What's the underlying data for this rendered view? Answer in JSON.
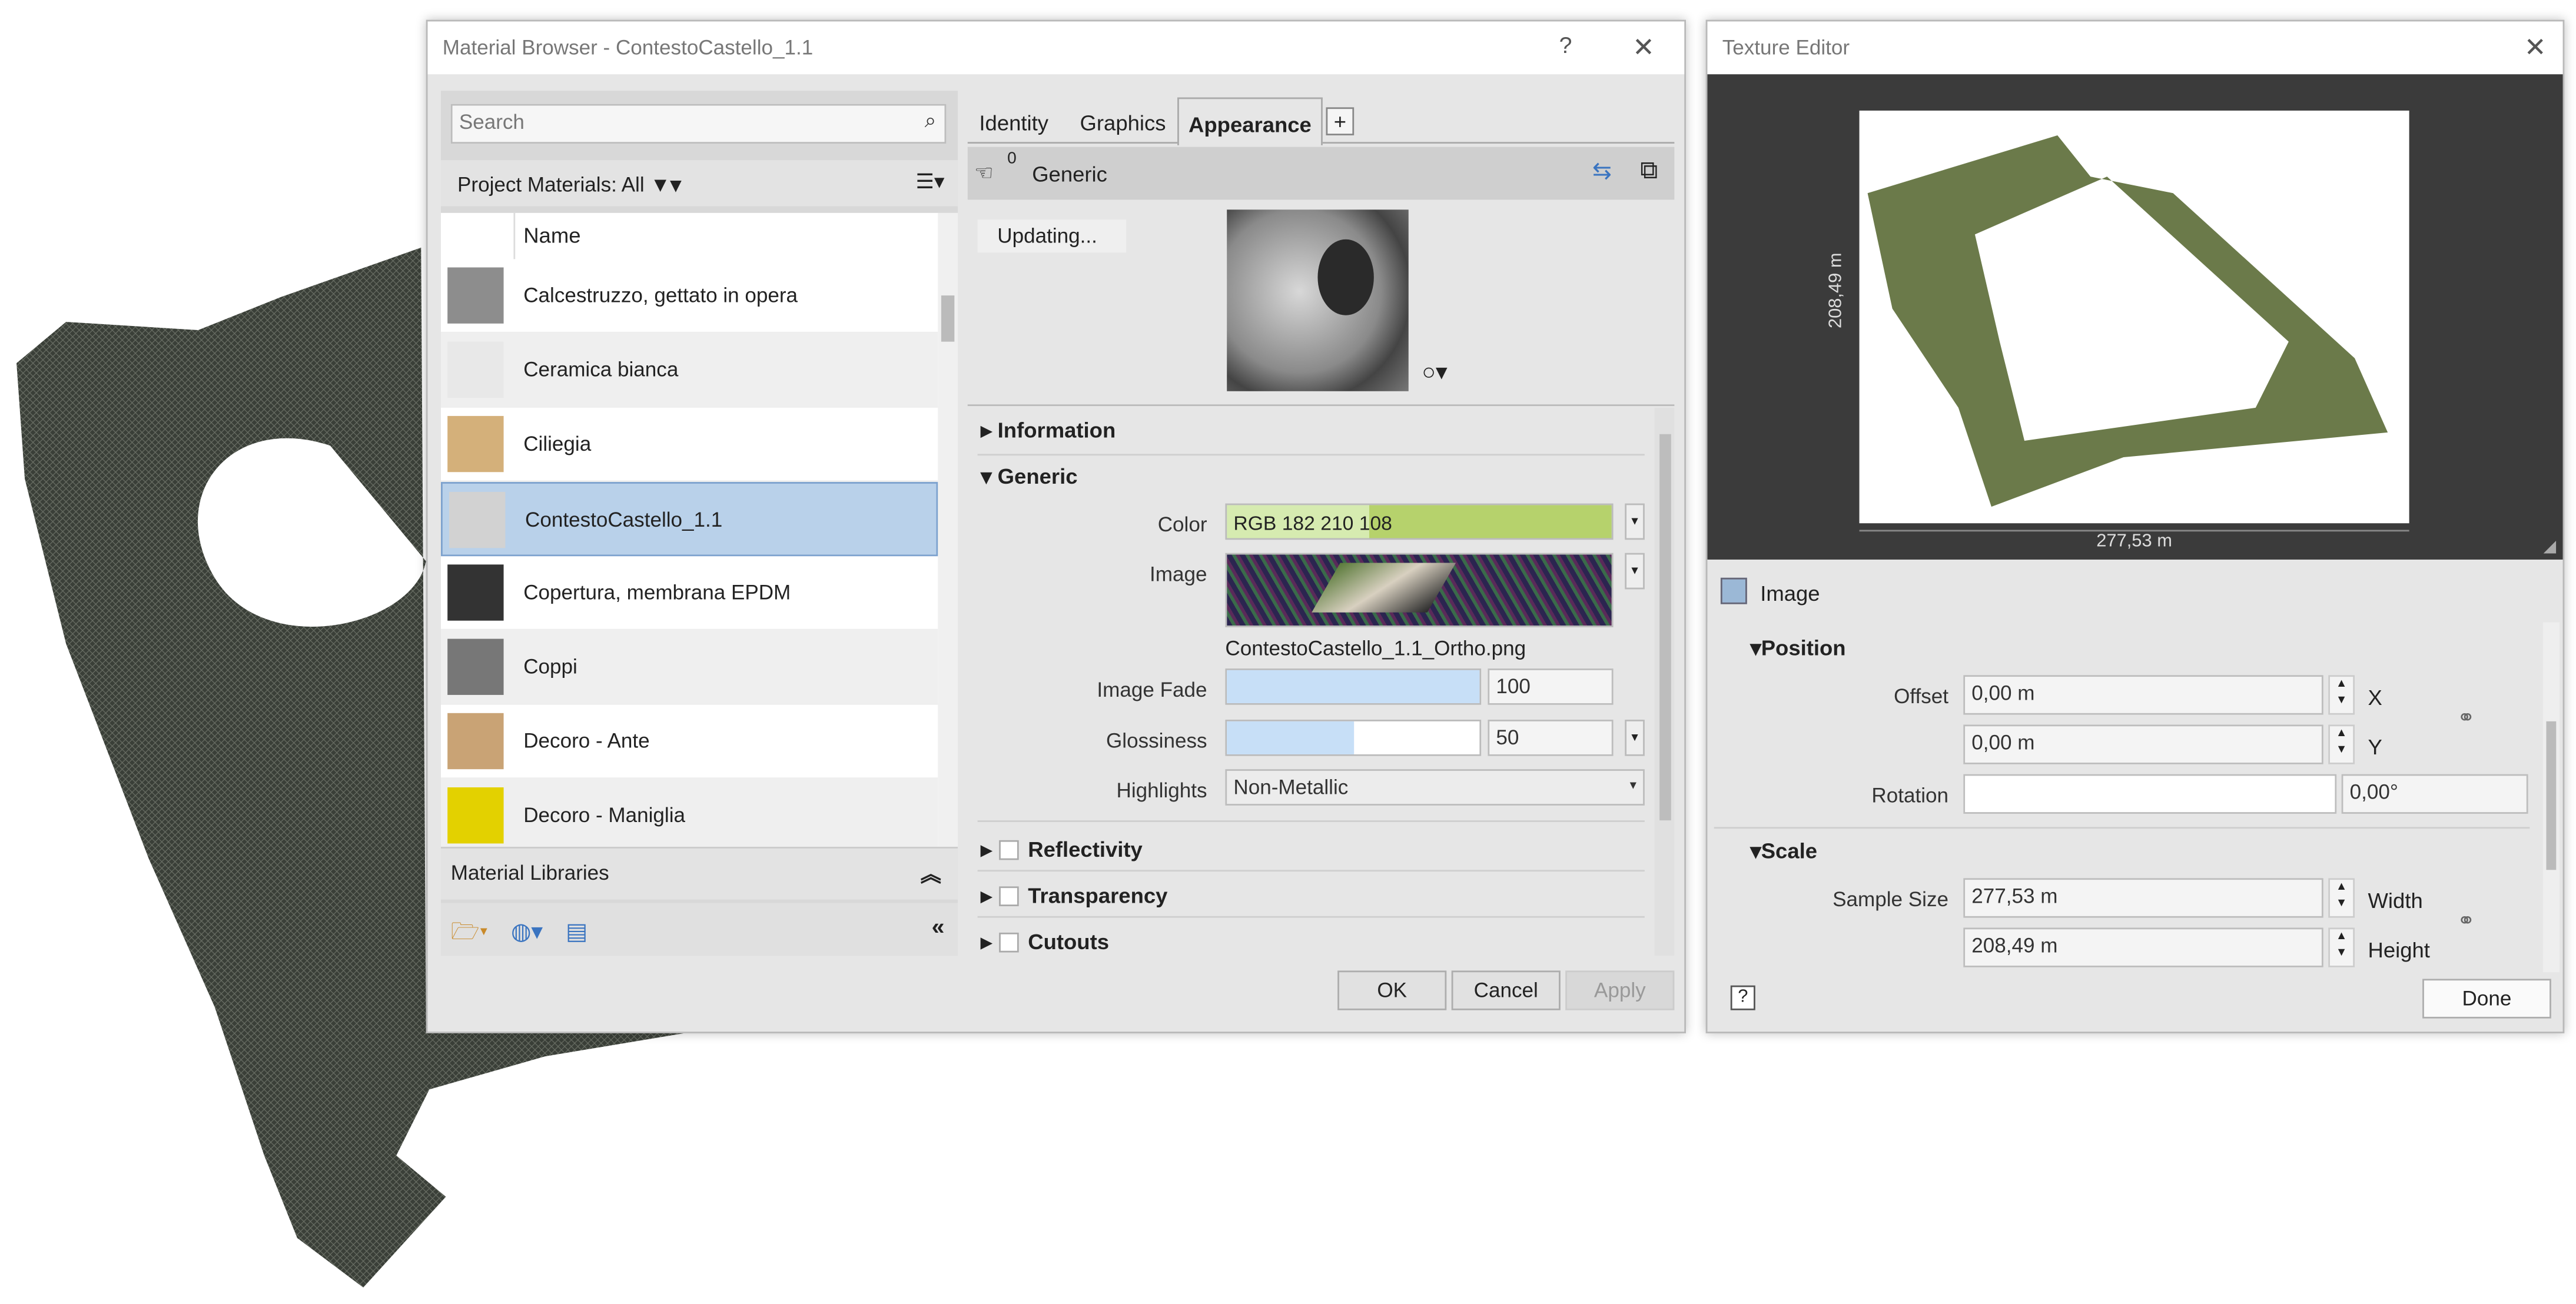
{
  "material_browser": {
    "title": "Material Browser - ContestoCastello_1.1",
    "help": "?",
    "close": "✕",
    "search_placeholder": "Search",
    "filter_label": "Project Materials: All",
    "list_header": "Name",
    "materials": [
      {
        "name": "Calcestruzzo, gettato in opera",
        "swatch": "#8d8d8d"
      },
      {
        "name": "Ceramica bianca",
        "swatch": "#e8e8e8"
      },
      {
        "name": "Ciliegia",
        "swatch": "#d4b07a"
      },
      {
        "name": "ContestoCastello_1.1",
        "swatch": "#d2d2d2"
      },
      {
        "name": "Copertura, membrana EPDM",
        "swatch": "#333333"
      },
      {
        "name": "Coppi",
        "swatch": "#777777"
      },
      {
        "name": "Decoro - Ante",
        "swatch": "#c9a375"
      },
      {
        "name": "Decoro - Maniglia",
        "swatch": "#e3d100"
      }
    ],
    "libraries_label": "Material Libraries",
    "tabs": [
      "Identity",
      "Graphics",
      "Appearance",
      "+"
    ],
    "asset_count": "0",
    "asset_name": "Generic",
    "updating": "Updating...",
    "sections": {
      "information": "Information",
      "generic": "Generic",
      "reflectivity": "Reflectivity",
      "transparency": "Transparency",
      "cutouts": "Cutouts"
    },
    "props": {
      "color_label": "Color",
      "color_value": "RGB 182 210 108",
      "color_hex": "#b6d26c",
      "image_label": "Image",
      "image_file": "ContestoCastello_1.1_Ortho.png",
      "fade_label": "Image Fade",
      "fade_value": "100",
      "fade_fraction": 1.0,
      "gloss_label": "Glossiness",
      "gloss_value": "50",
      "gloss_fraction": 0.5,
      "highlights_label": "Highlights",
      "highlights_value": "Non-Metallic"
    },
    "buttons": {
      "ok": "OK",
      "cancel": "Cancel",
      "apply": "Apply"
    }
  },
  "texture_editor": {
    "title": "Texture Editor",
    "close": "✕",
    "dim_height": "208,49 m",
    "dim_width": "277,53 m",
    "image_label": "Image",
    "position_label": "Position",
    "offset_label": "Offset",
    "offset_x": "0,00 m",
    "offset_y": "0,00 m",
    "x_label": "X",
    "y_label": "Y",
    "rotation_label": "Rotation",
    "rotation_value": "0,00°",
    "scale_label": "Scale",
    "sample_size_label": "Sample Size",
    "width_value": "277,53 m",
    "height_value": "208,49 m",
    "width_label": "Width",
    "height_label": "Height",
    "help": "?",
    "done": "Done"
  }
}
